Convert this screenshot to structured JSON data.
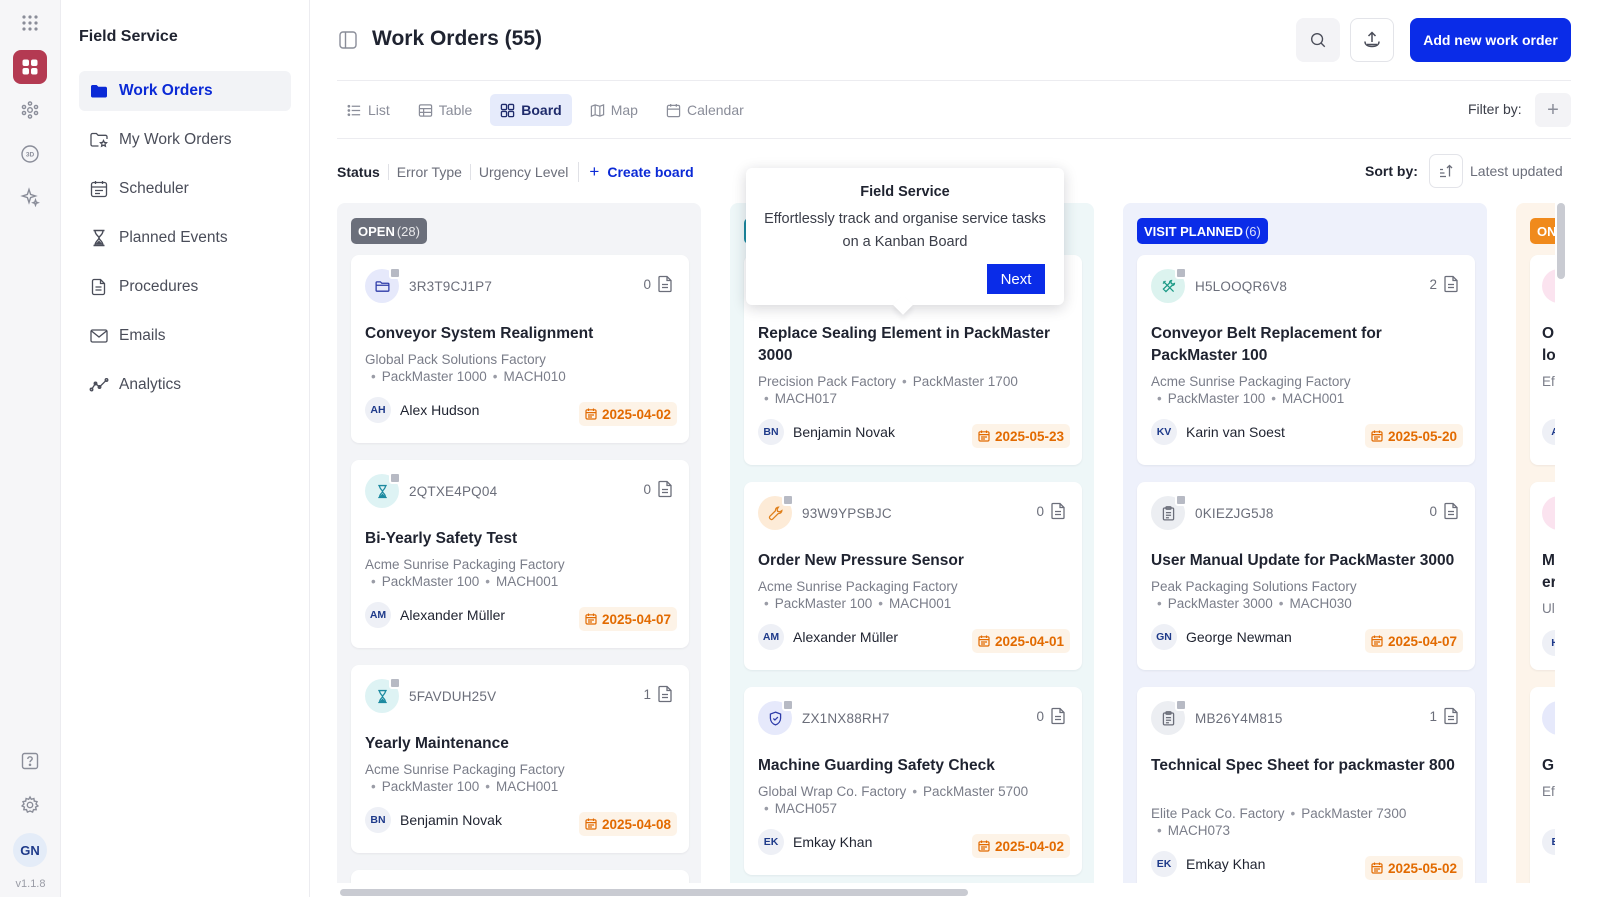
{
  "app": {
    "name": "Field Service",
    "version": "v1.1.8",
    "user_initials": "GN"
  },
  "sidebar": {
    "items": [
      {
        "label": "Work Orders",
        "icon": "folder-icon",
        "active": true
      },
      {
        "label": "My Work Orders",
        "icon": "folder-star-icon",
        "active": false
      },
      {
        "label": "Scheduler",
        "icon": "calendar-icon",
        "active": false
      },
      {
        "label": "Planned Events",
        "icon": "hourglass-icon",
        "active": false
      },
      {
        "label": "Procedures",
        "icon": "document-icon",
        "active": false
      },
      {
        "label": "Emails",
        "icon": "mail-icon",
        "active": false
      },
      {
        "label": "Analytics",
        "icon": "analytics-icon",
        "active": false
      }
    ]
  },
  "header": {
    "title": "Work Orders (55)",
    "add_button": "Add new work order"
  },
  "views": {
    "tabs": [
      "List",
      "Table",
      "Board",
      "Map",
      "Calendar"
    ],
    "active": "Board",
    "filter_label": "Filter by:"
  },
  "groups": {
    "items": [
      "Status",
      "Error Type",
      "Urgency Level"
    ],
    "create_board": "Create board",
    "sort_label": "Sort by:",
    "sort_value": "Latest updated"
  },
  "tour": {
    "title": "Field Service",
    "body": "Effortlessly track and organise service tasks on a Kanban Board",
    "next": "Next"
  },
  "colors": {
    "accent": "#0a2ce8",
    "open_badge": "#6b6f7b",
    "inprogress_badge": "#1c8aa0",
    "visit_badge": "#0a2ce8",
    "onhold_badge": "#f08a1c",
    "date_text": "#e26a00"
  },
  "columns": [
    {
      "status": "OPEN",
      "count": "(28)",
      "cards": [
        {
          "code": "3R3T9CJ1P7",
          "attachments": "0",
          "icon": "folder-icon",
          "title": "Conveyor System Realignment",
          "line1": "Global Pack Solutions Factory",
          "line2": "PackMaster 1000",
          "line3": "MACH010",
          "initials": "AH",
          "assignee": "Alex Hudson",
          "date": "2025-04-02"
        },
        {
          "code": "2QTXE4PQ04",
          "attachments": "0",
          "icon": "hourglass-icon",
          "title": "Bi-Yearly Safety Test",
          "line1": "Acme Sunrise Packaging Factory",
          "line2": "PackMaster 100",
          "line3": "MACH001",
          "initials": "AM",
          "assignee": "Alexander Müller",
          "date": "2025-04-07"
        },
        {
          "code": "5FAVDUH25V",
          "attachments": "1",
          "icon": "hourglass-icon",
          "title": "Yearly Maintenance",
          "line1": "Acme Sunrise Packaging Factory",
          "line2": "PackMaster 100",
          "line3": "MACH001",
          "initials": "BN",
          "assignee": "Benjamin Novak",
          "date": "2025-04-08"
        }
      ]
    },
    {
      "status": "",
      "count": "",
      "cards": [
        {
          "title": "Replace Sealing Element in PackMaster 3000",
          "line1": "Precision Pack Factory",
          "line2": "PackMaster 1700",
          "line3": "MACH017",
          "initials": "BN",
          "assignee": "Benjamin Novak",
          "date": "2025-05-23"
        },
        {
          "code": "93W9YPSBJC",
          "attachments": "0",
          "icon": "wrench-icon",
          "title": "Order New Pressure Sensor",
          "line1": "Acme Sunrise Packaging Factory",
          "line2": "PackMaster 100",
          "line3": "MACH001",
          "initials": "AM",
          "assignee": "Alexander Müller",
          "date": "2025-04-01"
        },
        {
          "code": "ZX1NX88RH7",
          "attachments": "0",
          "icon": "shield-icon",
          "title": "Machine Guarding Safety Check",
          "line1": "Global Wrap Co. Factory",
          "line2": "PackMaster 5700",
          "line3": "MACH057",
          "initials": "EK",
          "assignee": "Emkay Khan",
          "date": "2025-04-02"
        }
      ]
    },
    {
      "status": "VISIT PLANNED",
      "count": "(6)",
      "cards": [
        {
          "code": "H5LOOQR6V8",
          "attachments": "2",
          "icon": "tools-icon",
          "title": "Conveyor Belt Replacement for PackMaster 100",
          "line1": "Acme Sunrise Packaging Factory",
          "line2": "PackMaster 100",
          "line3": "MACH001",
          "initials": "KV",
          "assignee": "Karin van Soest",
          "date": "2025-05-20"
        },
        {
          "code": "0KIEZJG5J8",
          "attachments": "0",
          "icon": "clipboard-icon",
          "title": "User Manual Update for PackMaster 3000",
          "line1": "Peak Packaging Solutions Factory",
          "line2": "PackMaster 3000",
          "line3": "MACH030",
          "initials": "GN",
          "assignee": "George Newman",
          "date": "2025-04-07"
        },
        {
          "code": "MB26Y4M815",
          "attachments": "1",
          "icon": "clipboard-icon",
          "title": "Technical Spec Sheet for packmaster 800",
          "line1": "Elite Pack Co. Factory",
          "line2": "PackMaster 7300",
          "line3": "MACH073",
          "initials": "EK",
          "assignee": "Emkay Khan",
          "date": "2025-05-02"
        }
      ]
    },
    {
      "status": "ON",
      "count": "",
      "cards": [
        {
          "title": "O",
          "title2": "lo",
          "line1": "Ef",
          "initials": "A"
        },
        {
          "title": "M",
          "title2": "er",
          "line1": "Ul",
          "initials": "H"
        },
        {
          "title": "G",
          "line1": "Ef",
          "initials": "E"
        }
      ]
    }
  ]
}
